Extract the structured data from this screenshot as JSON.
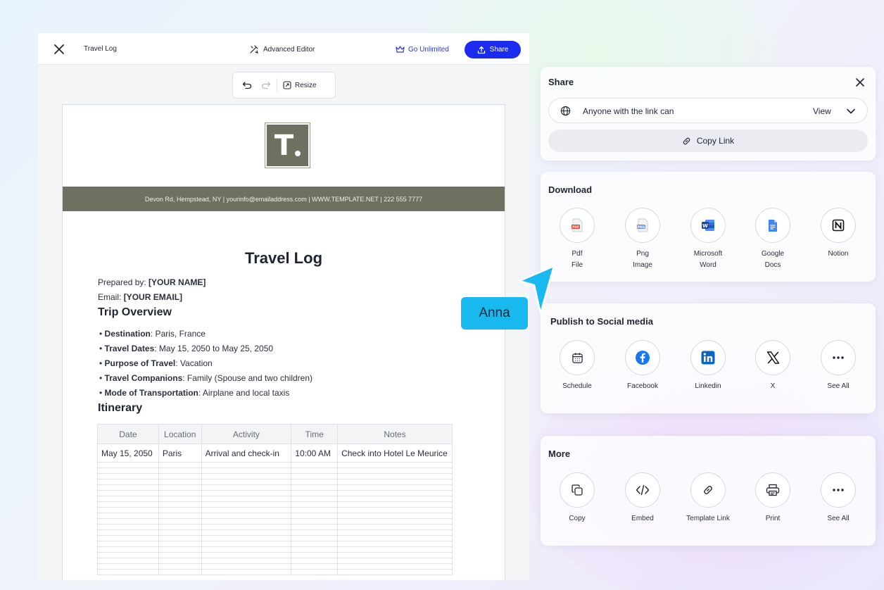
{
  "editor": {
    "doc_title": "Travel Log",
    "advanced_editor": "Advanced Editor",
    "go_unlimited": "Go Unlimited",
    "share": "Share",
    "resize": "Resize"
  },
  "document": {
    "contact_band": "Devon Rd, Hempstead, NY | yourinfo@emailaddress.com | WWW.TEMPLATE.NET | 222 555 7777",
    "title": "Travel Log",
    "prepared_label": "Prepared by: ",
    "prepared_value": "[YOUR NAME]",
    "email_label": "Email: ",
    "email_value": "[YOUR EMAIL]",
    "trip_overview": "Trip Overview",
    "bullets": [
      {
        "k": "Destination",
        "v": ": Paris, France"
      },
      {
        "k": "Travel Dates",
        "v": ": May 15, 2050 to May 25, 2050"
      },
      {
        "k": "Purpose of Travel",
        "v": ": Vacation"
      },
      {
        "k": "Travel Companions",
        "v": ": Family (Spouse and two children)"
      },
      {
        "k": "Mode of Transportation",
        "v": ": Airplane and local taxis"
      }
    ],
    "itinerary": "Itinerary",
    "table_headers": [
      "Date",
      "Location",
      "Activity",
      "Time",
      "Notes"
    ],
    "table_row": [
      "May 15, 2050",
      "Paris",
      "Arrival and check-in",
      "10:00 AM",
      "Check into Hotel Le Meurice"
    ]
  },
  "share_panel": {
    "title": "Share",
    "access_text": "Anyone with the link can",
    "access_level": "View",
    "copy_link": "Copy Link"
  },
  "download_panel": {
    "title": "Download",
    "options": [
      {
        "line1": "Pdf",
        "line2": "File",
        "icon": "pdf-icon"
      },
      {
        "line1": "Png",
        "line2": "Image",
        "icon": "png-icon"
      },
      {
        "line1": "Microsoft",
        "line2": "Word",
        "icon": "word-icon"
      },
      {
        "line1": "Google",
        "line2": "Docs",
        "icon": "google-docs-icon"
      },
      {
        "line1": "Notion",
        "line2": "",
        "icon": "notion-icon"
      }
    ]
  },
  "social_panel": {
    "title": "Publish to Social media",
    "options": [
      {
        "label": "Schedule",
        "icon": "calendar-icon"
      },
      {
        "label": "Facebook",
        "icon": "facebook-icon"
      },
      {
        "label": "Linkedin",
        "icon": "linkedin-icon"
      },
      {
        "label": "X",
        "icon": "x-icon"
      },
      {
        "label": "See All",
        "icon": "more-icon"
      }
    ]
  },
  "more_panel": {
    "title": "More",
    "options": [
      {
        "label": "Copy",
        "icon": "copy-icon"
      },
      {
        "label": "Embed",
        "icon": "embed-icon"
      },
      {
        "label": "Template Link",
        "icon": "link-icon"
      },
      {
        "label": "Print",
        "icon": "print-icon"
      },
      {
        "label": "See All",
        "icon": "more-icon"
      }
    ]
  },
  "cursor_label": "Anna",
  "colors": {
    "accent": "#1b2bf0",
    "doc_band": "#6f7060",
    "cursor": "#19b8ee"
  }
}
